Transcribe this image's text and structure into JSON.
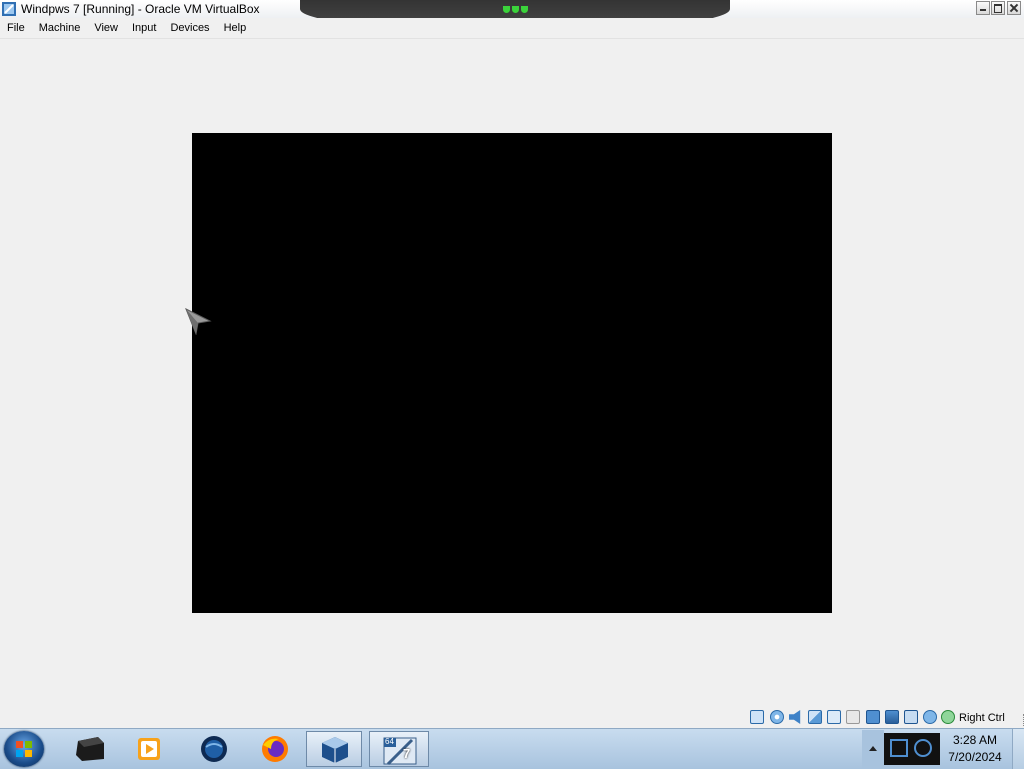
{
  "window": {
    "title": "Windpws 7 [Running] - Oracle VM VirtualBox",
    "icon": "virtualbox-icon",
    "controls": [
      "minimize-icon",
      "maximize-icon",
      "close-icon"
    ]
  },
  "menubar": {
    "items": [
      "File",
      "Machine",
      "View",
      "Input",
      "Devices",
      "Help"
    ]
  },
  "vm": {
    "screen_color": "#000000",
    "cursor_icon": "mouse-pointer-icon"
  },
  "statusbar": {
    "icons": [
      "hard-disk-icon",
      "optical-drive-icon",
      "audio-icon",
      "network-icon",
      "usb-icon",
      "shared-folders-icon",
      "display-icon",
      "capture-icon",
      "virtualization-icon",
      "mouse-integration-icon",
      "keyboard-icon"
    ],
    "host_key": "Right Ctrl"
  },
  "taskbar": {
    "start_icon": "windows-start-icon",
    "buttons": [
      {
        "icon": "terminal-app-icon"
      },
      {
        "icon": "media-player-icon"
      },
      {
        "icon": "browser-globe-icon"
      },
      {
        "icon": "firefox-icon"
      },
      {
        "icon": "virtualbox-icon",
        "active": true
      },
      {
        "icon": "windows7-vm-icon",
        "active": true,
        "badge": "64",
        "number": "7"
      }
    ],
    "clock": {
      "time": "3:28 AM",
      "date": "7/20/2024"
    }
  }
}
